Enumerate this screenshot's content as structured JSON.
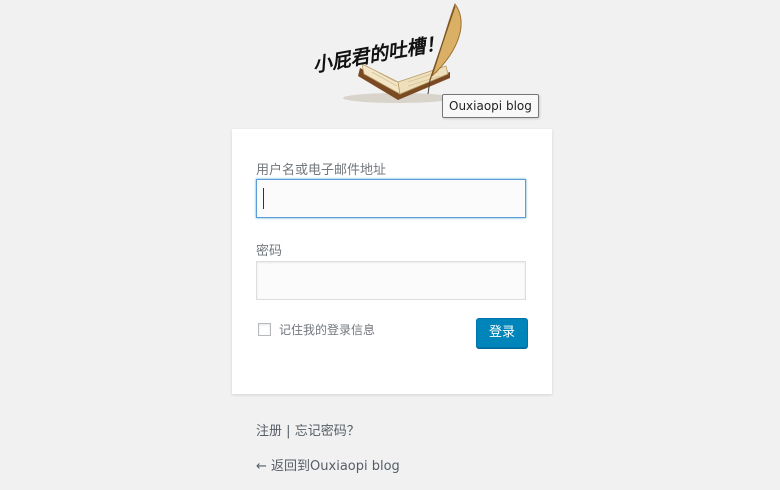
{
  "logo": {
    "tagline": "小屁君的吐槽！",
    "tooltip": "Ouxiaopi blog"
  },
  "form": {
    "username_label": "用户名或电子邮件地址",
    "username_value": "",
    "password_label": "密码",
    "password_value": "",
    "remember_label": "记住我的登录信息",
    "remember_checked": false,
    "submit_label": "登录"
  },
  "links": {
    "register": "注册",
    "separator": "|",
    "lost_password": "忘记密码？",
    "back_arrow": "←",
    "back_to_site": "返回到Ouxiaopi blog"
  },
  "colors": {
    "page_bg": "#f1f1f1",
    "primary_button": "#0085ba",
    "focus_border": "#5b9dd9"
  }
}
